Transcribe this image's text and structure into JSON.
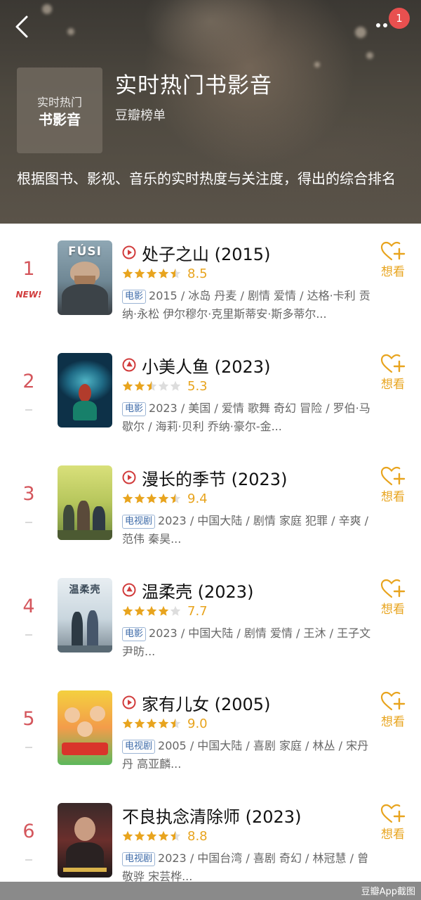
{
  "header": {
    "title": "实时热门书影音",
    "subtitle": "豆瓣榜单",
    "description": "根据图书、影视、音乐的实时热度与关注度，得出的综合排名",
    "cover_line1": "实时热门",
    "cover_line2": "书影音",
    "notification_count": "1",
    "back_icon": "chevron-left-icon",
    "more_icon": "more-dots-icon"
  },
  "want_label": "想看",
  "colors": {
    "accent": "#e8a41e",
    "rank": "#d4565c",
    "badge_border": "#9bb4d4",
    "badge_text": "#3c6aa8",
    "notification": "#e8504f"
  },
  "items": [
    {
      "rank": "1",
      "tag": "NEW!",
      "play_icon": "play-circle-icon",
      "title": "处子之山 (2015)",
      "stars": 4.5,
      "score": "8.5",
      "type": "电影",
      "poster_text": "FÚSI",
      "meta": "2015 / 冰岛 丹麦 / 剧情 爱情 / 达格·卡利 贡纳·永松 伊尔穆尔·克里斯蒂安·斯多蒂尔..."
    },
    {
      "rank": "2",
      "tag": "",
      "play_icon": "douban-play-icon",
      "title": "小美人鱼 (2023)",
      "stars": 2.5,
      "score": "5.3",
      "type": "电影",
      "poster_text": "",
      "meta": "2023 / 美国 / 爱情 歌舞 奇幻 冒险 / 罗伯·马歇尔 / 海莉·贝利 乔纳·豪尔-金..."
    },
    {
      "rank": "3",
      "tag": "",
      "play_icon": "play-circle-icon",
      "title": "漫长的季节 (2023)",
      "stars": 4.5,
      "score": "9.4",
      "type": "电视剧",
      "poster_text": "",
      "meta": "2023 / 中国大陆 / 剧情 家庭 犯罪 / 辛爽 / 范伟 秦昊..."
    },
    {
      "rank": "4",
      "tag": "",
      "play_icon": "douban-play-icon",
      "title": "温柔壳 (2023)",
      "stars": 4,
      "score": "7.7",
      "type": "电影",
      "poster_text": "温柔壳",
      "meta": "2023 / 中国大陆 / 剧情 爱情 / 王沐 / 王子文 尹昉..."
    },
    {
      "rank": "5",
      "tag": "",
      "play_icon": "play-circle-icon",
      "title": "家有儿女 (2005)",
      "stars": 4.5,
      "score": "9.0",
      "type": "电视剧",
      "poster_text": "",
      "meta": "2005 / 中国大陆 / 喜剧 家庭 / 林丛 / 宋丹丹 高亚麟..."
    },
    {
      "rank": "6",
      "tag": "",
      "play_icon": "",
      "title": "不良执念清除师 (2023)",
      "stars": 4.5,
      "score": "8.8",
      "type": "电视剧",
      "poster_text": "",
      "meta": "2023 / 中国台湾 / 喜剧 奇幻 / 林冠慧 / 曾敬骅 宋芸桦..."
    }
  ],
  "footer": {
    "watermark": "豆瓣App截图"
  }
}
